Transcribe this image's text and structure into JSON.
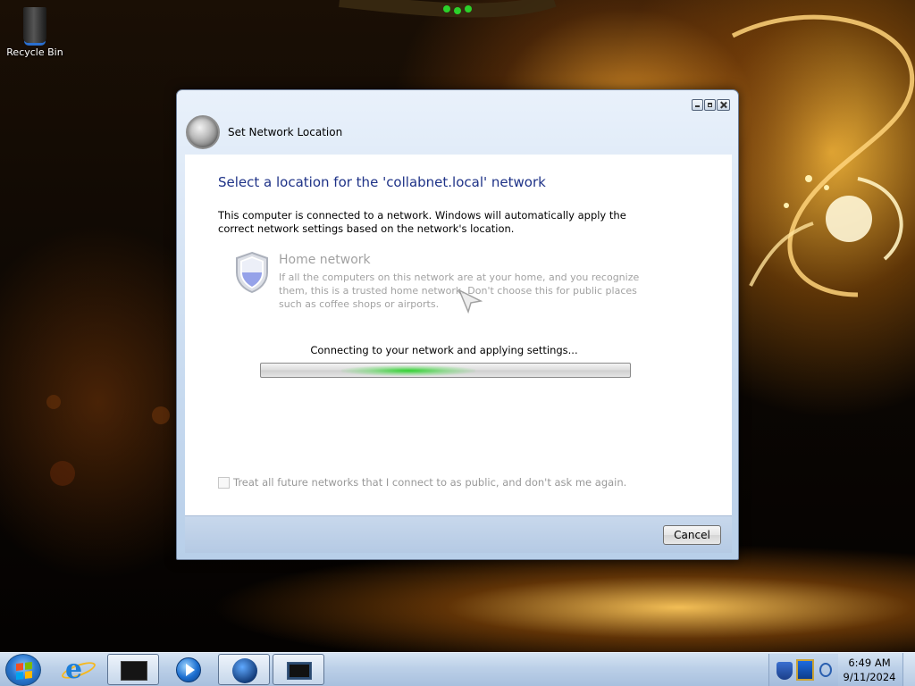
{
  "desktop": {
    "icons": [
      {
        "label": "Recycle Bin"
      }
    ]
  },
  "dialog": {
    "title": "Set Network Location",
    "heading": "Select a location for the 'collabnet.local' network",
    "description": "This computer is connected to a network. Windows will automatically apply the correct network settings based on the network's location.",
    "options": [
      {
        "title": "Home network",
        "description": "If all the computers on this network are at your home, and you recognize them, this is a trusted home network.  Don't choose this for public places such as coffee shops or airports."
      }
    ],
    "status": "Connecting to your network and applying settings...",
    "checkbox_label": "Treat all future networks that I connect to as public, and don't ask me again.",
    "checkbox_checked": false,
    "cancel_label": "Cancel"
  },
  "taskbar": {
    "pinned": [
      {
        "icon": "start-orb-icon"
      },
      {
        "icon": "internet-explorer-icon"
      },
      {
        "icon": "windows-explorer-icon"
      },
      {
        "icon": "media-player-icon"
      },
      {
        "icon": "network-globe-icon"
      },
      {
        "icon": "set-network-location-window-icon"
      }
    ],
    "tray": {
      "icons": [
        "action-center-shield-icon",
        "network-status-icon",
        "volume-icon"
      ],
      "time": "6:49 AM",
      "date": "9/11/2024"
    }
  },
  "colors": {
    "heading": "#1e3287",
    "progress_glow": "#28d228",
    "dialog_frame": "#c9dbf0"
  }
}
